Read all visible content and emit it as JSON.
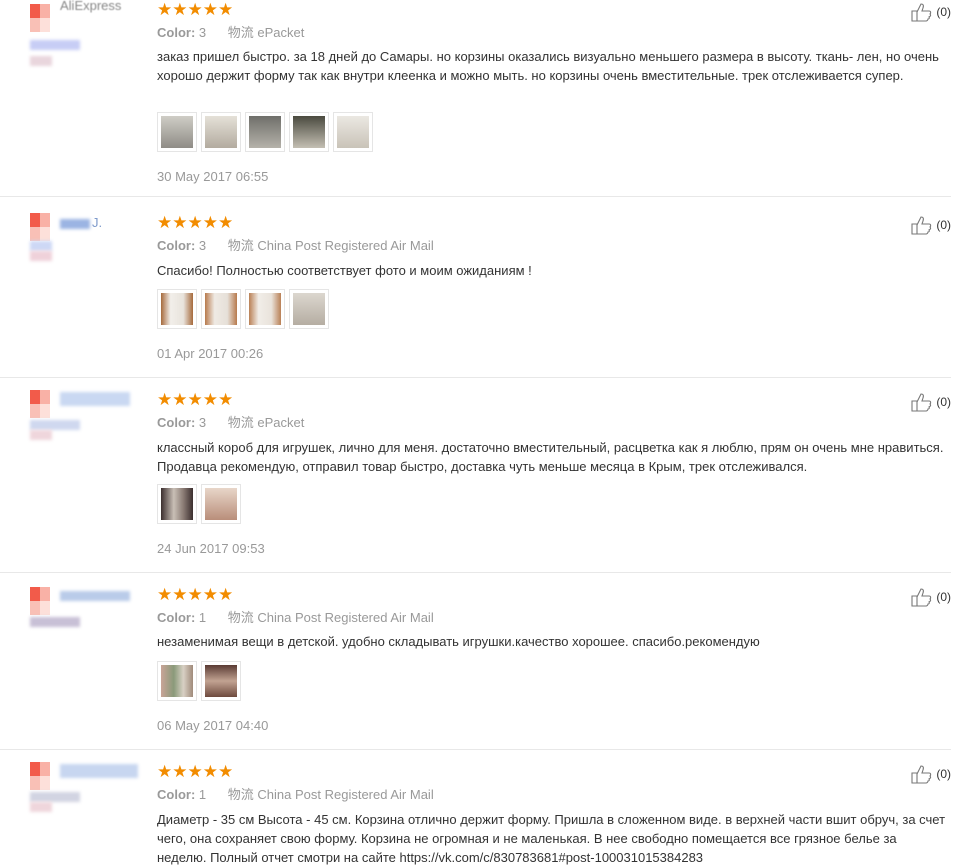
{
  "reviews": [
    {
      "username": "AliExpress",
      "rating": "★★★★★",
      "color_label": "Color:",
      "color_value": "3",
      "shipping_label": "物流",
      "shipping_value": "ePacket",
      "text": "заказ пришел быстро. за 18 дней до Самары. но корзины оказались визуально меньшего размера в высоту. ткань- лен, но очень хорошо держит форму так как внутри клеенка и можно мыть. но корзины очень вместительные. трек отслеживается супер.",
      "photos": [
        "#b9b7b0",
        "#cfcac2",
        "#9a9894",
        "#8c8577",
        "#d8d4cc"
      ],
      "date": "30 May 2017 06:55",
      "useful": "(0)"
    },
    {
      "username": "J.",
      "rating": "★★★★★",
      "color_label": "Color:",
      "color_value": "3",
      "shipping_label": "物流",
      "shipping_value": "China Post Registered Air Mail",
      "text": "Спасибо! Полностью соответствует фото и моим ожиданиям !",
      "photos": [
        "#c8a687",
        "#c4a88e",
        "#c9ad8f",
        "#c7c2b8"
      ],
      "date": "01 Apr 2017 00:26",
      "useful": "(0)"
    },
    {
      "username": "",
      "rating": "★★★★★",
      "color_label": "Color:",
      "color_value": "3",
      "shipping_label": "物流",
      "shipping_value": "ePacket",
      "text": "классный короб для игрушек, лично для меня. достаточно вместительный, расцветка как я люблю, прям он очень мне нравиться. Продавца рекомендую, отправил товар быстро, доставка чуть меньше месяца в Крым, трек отслеживался.",
      "photos": [
        "#7a6a68",
        "#c9a99a"
      ],
      "date": "24 Jun 2017 09:53",
      "useful": "(0)"
    },
    {
      "username": "",
      "rating": "★★★★★",
      "color_label": "Color:",
      "color_value": "1",
      "shipping_label": "物流",
      "shipping_value": "China Post Registered Air Mail",
      "text": "незаменимая вещи в детской. удобно складывать игрушки.качество хорошее. спасибо.рекомендую",
      "photos": [
        "#a79784",
        "#8a6e62"
      ],
      "date": "06 May 2017 04:40",
      "useful": "(0)"
    },
    {
      "username": "",
      "rating": "★★★★★",
      "color_label": "Color:",
      "color_value": "1",
      "shipping_label": "物流",
      "shipping_value": "China Post Registered Air Mail",
      "text": "Диаметр - 35 см Высота - 45 см. Корзина отлично держит форму. Пришла в сложенном виде. в верхней части вшит обруч, за счет чего, она сохраняет свою форму. Корзина не огромная и не маленькая. В нее свободно помещается все грязное белье за неделю. Полный отчет смотри на сайте https://vk.com/c/830783681#post-100031015384283",
      "photos": [],
      "date": "",
      "useful": "(0)"
    }
  ],
  "colors": {
    "star": "#f28c00",
    "meta": "#999999",
    "divider": "#e8e8e8",
    "flag_red": "#f25b4a",
    "flag_pink": "#f9b1a6"
  }
}
